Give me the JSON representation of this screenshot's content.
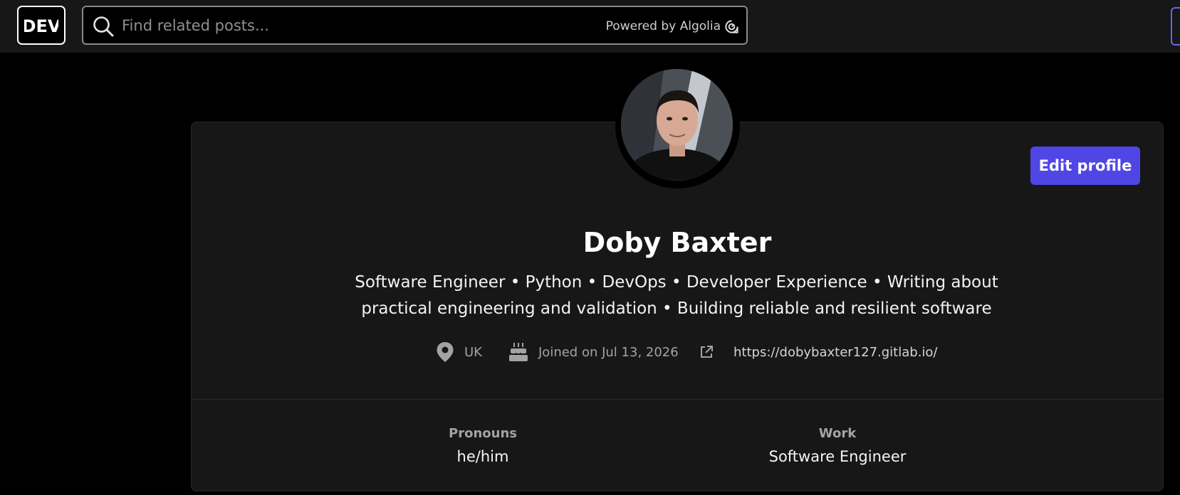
{
  "header": {
    "logo_text": "DEV",
    "search": {
      "placeholder": "Find related posts...",
      "powered_by": "Powered by Algolia"
    }
  },
  "profile": {
    "name": "Doby Baxter",
    "bio": "Software Engineer • Python • DevOps • Developer Experience • Writing about practical engineering and validation • Building reliable and resilient software",
    "edit_button": "Edit profile",
    "meta": {
      "location": "UK",
      "joined": "Joined on Jul 13, 2026",
      "website": "https://dobybaxter127.gitlab.io/"
    },
    "details": [
      {
        "label": "Pronouns",
        "value": "he/him"
      },
      {
        "label": "Work",
        "value": "Software Engineer"
      }
    ]
  },
  "colors": {
    "accent": "#4f46e5",
    "background": "#000000",
    "card": "#171717",
    "muted_text": "#a3a3a3"
  },
  "icons": {
    "search": "search-icon",
    "algolia": "algolia-icon",
    "location": "location-pin-icon",
    "joined": "cake-icon",
    "website": "external-link-icon"
  }
}
